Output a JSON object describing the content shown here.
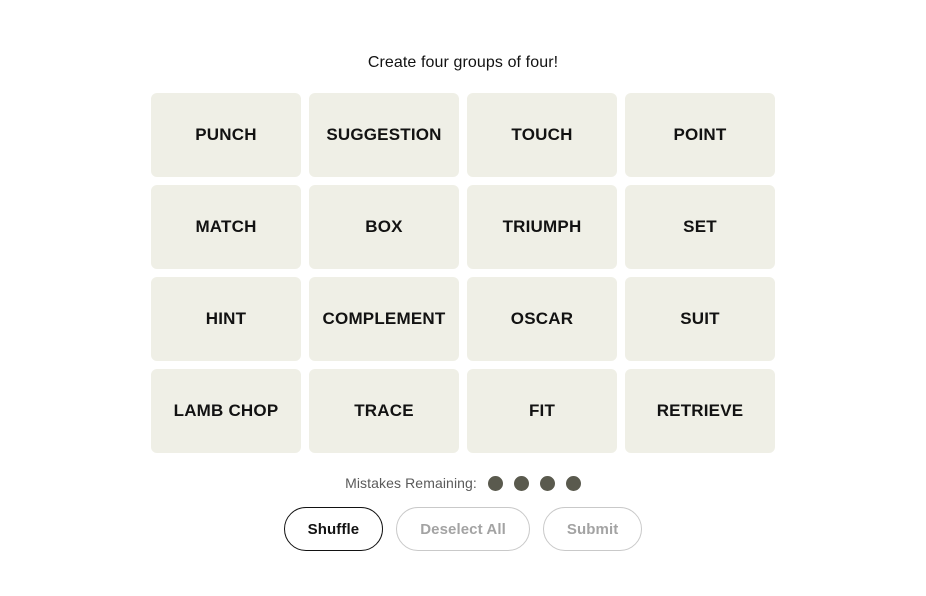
{
  "header": {
    "instruction": "Create four groups of four!"
  },
  "board": {
    "tiles": [
      {
        "label": "PUNCH"
      },
      {
        "label": "SUGGESTION"
      },
      {
        "label": "TOUCH"
      },
      {
        "label": "POINT"
      },
      {
        "label": "MATCH"
      },
      {
        "label": "BOX"
      },
      {
        "label": "TRIUMPH"
      },
      {
        "label": "SET"
      },
      {
        "label": "HINT"
      },
      {
        "label": "COMPLEMENT"
      },
      {
        "label": "OSCAR"
      },
      {
        "label": "SUIT"
      },
      {
        "label": "LAMB CHOP"
      },
      {
        "label": "TRACE"
      },
      {
        "label": "FIT"
      },
      {
        "label": "RETRIEVE"
      }
    ],
    "tile_background": "#EFEFE6",
    "tile_text_color": "#121212"
  },
  "mistakes": {
    "label": "Mistakes Remaining:",
    "remaining": 4,
    "dots": [
      1,
      2,
      3,
      4
    ],
    "dot_color": "#5A5A4E",
    "label_color": "#5A5A5A"
  },
  "controls": {
    "buttons": [
      {
        "label": "Shuffle",
        "state": "enabled"
      },
      {
        "label": "Deselect All",
        "state": "disabled"
      },
      {
        "label": "Submit",
        "state": "disabled"
      }
    ]
  }
}
